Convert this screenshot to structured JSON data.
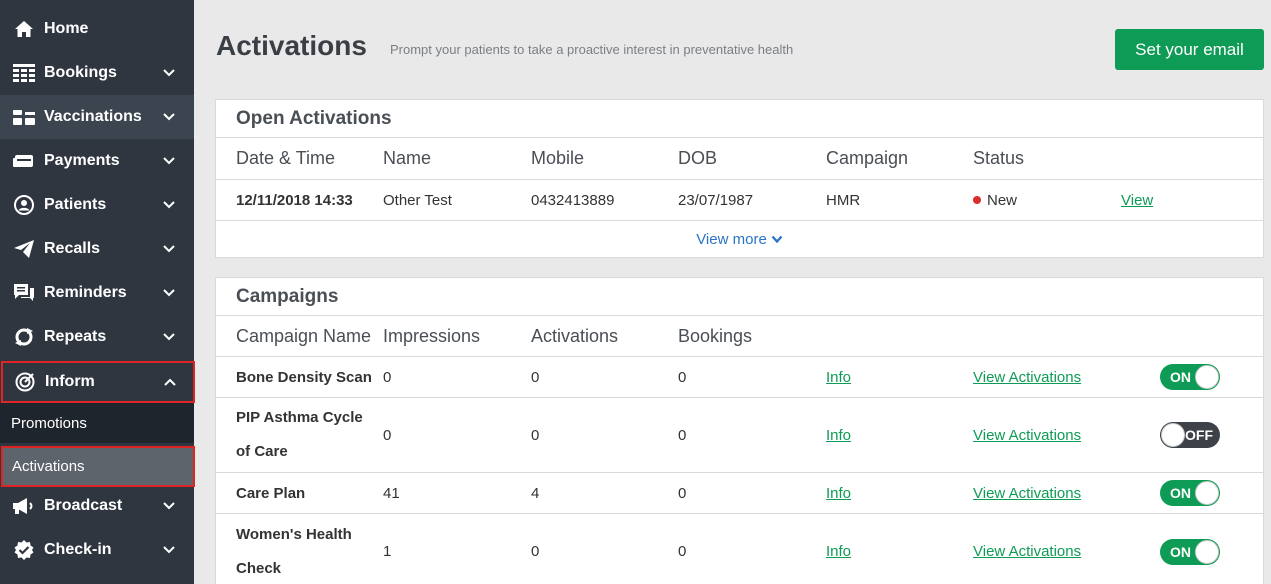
{
  "sidebar": {
    "items": [
      {
        "label": "Home",
        "icon": "home-icon",
        "has_chevron": false
      },
      {
        "label": "Bookings",
        "icon": "calendar-grid-icon",
        "has_chevron": true
      },
      {
        "label": "Vaccinations",
        "icon": "vaccine-icon",
        "has_chevron": true
      },
      {
        "label": "Payments",
        "icon": "payment-icon",
        "has_chevron": true
      },
      {
        "label": "Patients",
        "icon": "patient-icon",
        "has_chevron": true
      },
      {
        "label": "Recalls",
        "icon": "paper-plane-icon",
        "has_chevron": true
      },
      {
        "label": "Reminders",
        "icon": "chat-bubbles-icon",
        "has_chevron": true
      },
      {
        "label": "Repeats",
        "icon": "repeat-icon",
        "has_chevron": true
      },
      {
        "label": "Inform",
        "icon": "target-icon",
        "has_chevron": true,
        "expanded": true
      },
      {
        "label": "Broadcast",
        "icon": "megaphone-icon",
        "has_chevron": true
      },
      {
        "label": "Check-in",
        "icon": "check-badge-icon",
        "has_chevron": true
      }
    ],
    "subitems": [
      {
        "label": "Promotions"
      },
      {
        "label": "Activations",
        "selected": true
      }
    ]
  },
  "header": {
    "title": "Activations",
    "subtitle": "Prompt your patients to take a proactive interest in preventative health",
    "email_button": "Set your email"
  },
  "open_activations": {
    "title": "Open Activations",
    "columns": [
      "Date & Time",
      "Name",
      "Mobile",
      "DOB",
      "Campaign",
      "Status"
    ],
    "rows": [
      {
        "datetime": "12/11/2018 14:33",
        "name": "Other Test",
        "mobile": "0432413889",
        "dob": "23/07/1987",
        "campaign": "HMR",
        "status": "New",
        "action": "View"
      }
    ],
    "view_more": "View more"
  },
  "campaigns": {
    "title": "Campaigns",
    "columns": [
      "Campaign Name",
      "Impressions",
      "Activations",
      "Bookings"
    ],
    "rows": [
      {
        "name": "Bone Density Scan",
        "impressions": "0",
        "activations": "0",
        "bookings": "0",
        "info": "Info",
        "view": "View Activations",
        "toggle": "ON"
      },
      {
        "name": "PIP Asthma Cycle of Care",
        "impressions": "0",
        "activations": "0",
        "bookings": "0",
        "info": "Info",
        "view": "View Activations",
        "toggle": "OFF"
      },
      {
        "name": "Care Plan",
        "impressions": "41",
        "activations": "4",
        "bookings": "0",
        "info": "Info",
        "view": "View Activations",
        "toggle": "ON"
      },
      {
        "name": "Women's Health Check",
        "impressions": "1",
        "activations": "0",
        "bookings": "0",
        "info": "Info",
        "view": "View Activations",
        "toggle": "ON"
      }
    ]
  },
  "colors": {
    "sidebar_bg": "#2f3640",
    "accent_green": "#0e9b55",
    "link_blue": "#2a76c6",
    "status_new": "#d9302c",
    "highlight_red": "#e02424"
  }
}
